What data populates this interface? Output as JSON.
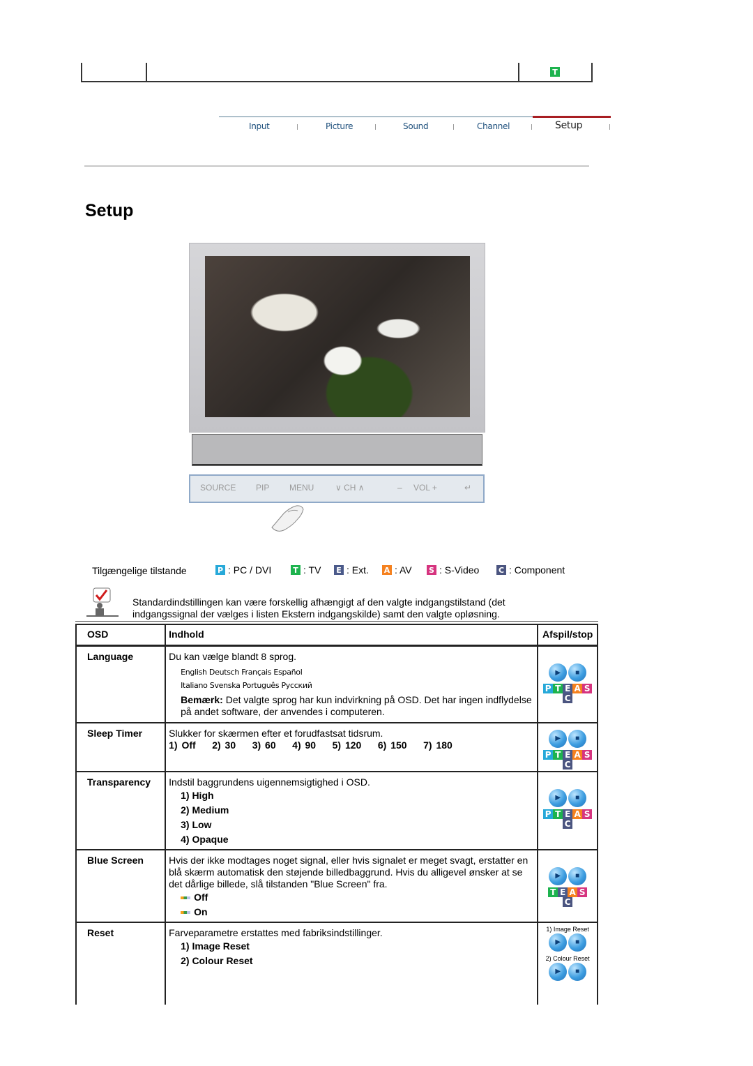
{
  "header": {
    "mode_badge": "T",
    "colors": {
      "P": "#27a9d9",
      "T": "#1db34e",
      "E": "#4b5a8a",
      "A": "#f5811f",
      "S": "#d6347f",
      "C": "#4b5580",
      "nav_active": "#a81e22",
      "nav_text": "#1d4f7c"
    }
  },
  "nav": {
    "tabs": [
      {
        "label": "Input"
      },
      {
        "label": "Picture"
      },
      {
        "label": "Sound"
      },
      {
        "label": "Channel"
      },
      {
        "label": "Setup",
        "active": true
      }
    ]
  },
  "page_title": "Setup",
  "control_panel": {
    "buttons": [
      "SOURCE",
      "PIP",
      "MENU",
      "∨ CH ∧",
      "–",
      "VOL +",
      "↵"
    ]
  },
  "legend": {
    "label": "Tilgængelige tilstande",
    "items": [
      {
        "badge": "P",
        "text": ": PC / DVI"
      },
      {
        "badge": "T",
        "text": ": TV"
      },
      {
        "badge": "E",
        "text": ": Ext."
      },
      {
        "badge": "A",
        "text": ": AV"
      },
      {
        "badge": "S",
        "text": ": S-Video"
      },
      {
        "badge": "C",
        "text": ": Component"
      }
    ]
  },
  "note": {
    "text": "Standardindstillingen kan være forskellig afhængigt af den valgte indgangstilstand (det indgangssignal der vælges i listen Ekstern indgangskilde) samt den valgte opløsning."
  },
  "table": {
    "headers": {
      "osd": "OSD",
      "content": "Indhold",
      "play": "Afspil/stop"
    },
    "rows": {
      "language": {
        "osd": "Language",
        "desc": "Du kan vælge blandt 8 sprog.",
        "langs_1": "English  Deutsch  Français  Español",
        "langs_2": "Italiano  Svenska  Português  Русский",
        "note_label": "Bemærk:",
        "note_text": " Det valgte sprog har kun indvirkning på OSD. Det har ingen indflydelse på andet software, der anvendes i computeren."
      },
      "sleep": {
        "osd": "Sleep Timer",
        "desc": "Slukker for skærmen efter et forudfastsat tidsrum.",
        "options": "1) Off    2) 30    3) 60    4) 90    5) 120    6) 150    7) 180"
      },
      "transparency": {
        "osd": "Transparency",
        "desc": "Indstil baggrundens uigennemsigtighed i OSD.",
        "options": [
          "1) High",
          "2) Medium",
          "3) Low",
          "4) Opaque"
        ]
      },
      "blue": {
        "osd": "Blue Screen",
        "desc": "Hvis der ikke modtages noget signal, eller hvis signalet er meget svagt, erstatter en blå skærm automatisk den støjende billedbaggrund. Hvis du alligevel ønsker at se det dårlige billede, slå tilstanden \"Blue Screen\" fra.",
        "options": [
          "Off",
          "On"
        ]
      },
      "reset": {
        "osd": "Reset",
        "desc": "Farveparametre erstattes med fabriksindstillinger.",
        "options": [
          "1) Image Reset",
          "2) Colour Reset"
        ],
        "play_labels": [
          "1) Image Reset",
          "2) Colour Reset"
        ]
      }
    },
    "mode_sets": {
      "full": [
        "P",
        "T",
        "E",
        "A",
        "S"
      ],
      "no_pc": [
        "T",
        "E",
        "A",
        "S"
      ],
      "extra": "C"
    }
  }
}
